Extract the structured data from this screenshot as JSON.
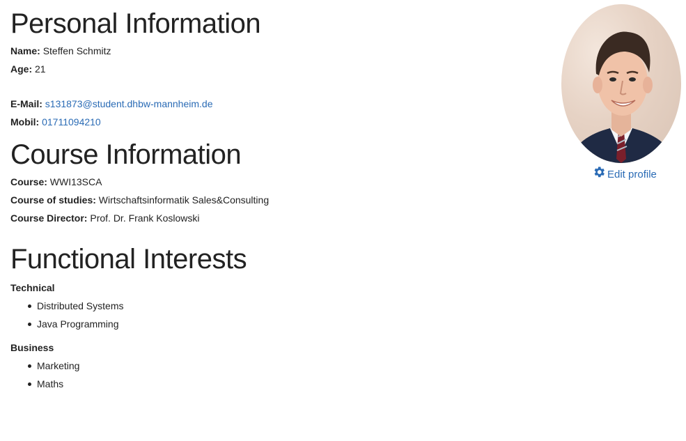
{
  "personal": {
    "heading": "Personal Information",
    "name_label": "Name:",
    "name_value": "Steffen Schmitz",
    "age_label": "Age:",
    "age_value": "21",
    "email_label": "E-Mail:",
    "email_value": "s131873@student.dhbw-mannheim.de",
    "mobil_label": "Mobil:",
    "mobil_value": "01711094210"
  },
  "course": {
    "heading": "Course Information",
    "course_label": "Course:",
    "course_value": "WWI13SCA",
    "studies_label": "Course of studies:",
    "studies_value": "Wirtschaftsinformatik Sales&Consulting",
    "director_label": "Course Director:",
    "director_value": "Prof. Dr. Frank Koslowski"
  },
  "interests": {
    "heading": "Functional Interests",
    "categories": [
      {
        "title": "Technical",
        "items": [
          "Distributed Systems",
          "Java Programming"
        ]
      },
      {
        "title": "Business",
        "items": [
          "Marketing",
          "Maths"
        ]
      }
    ]
  },
  "profile": {
    "edit_label": "Edit profile",
    "edit_icon": "gear-icon",
    "link_color": "#2a6bb5"
  }
}
